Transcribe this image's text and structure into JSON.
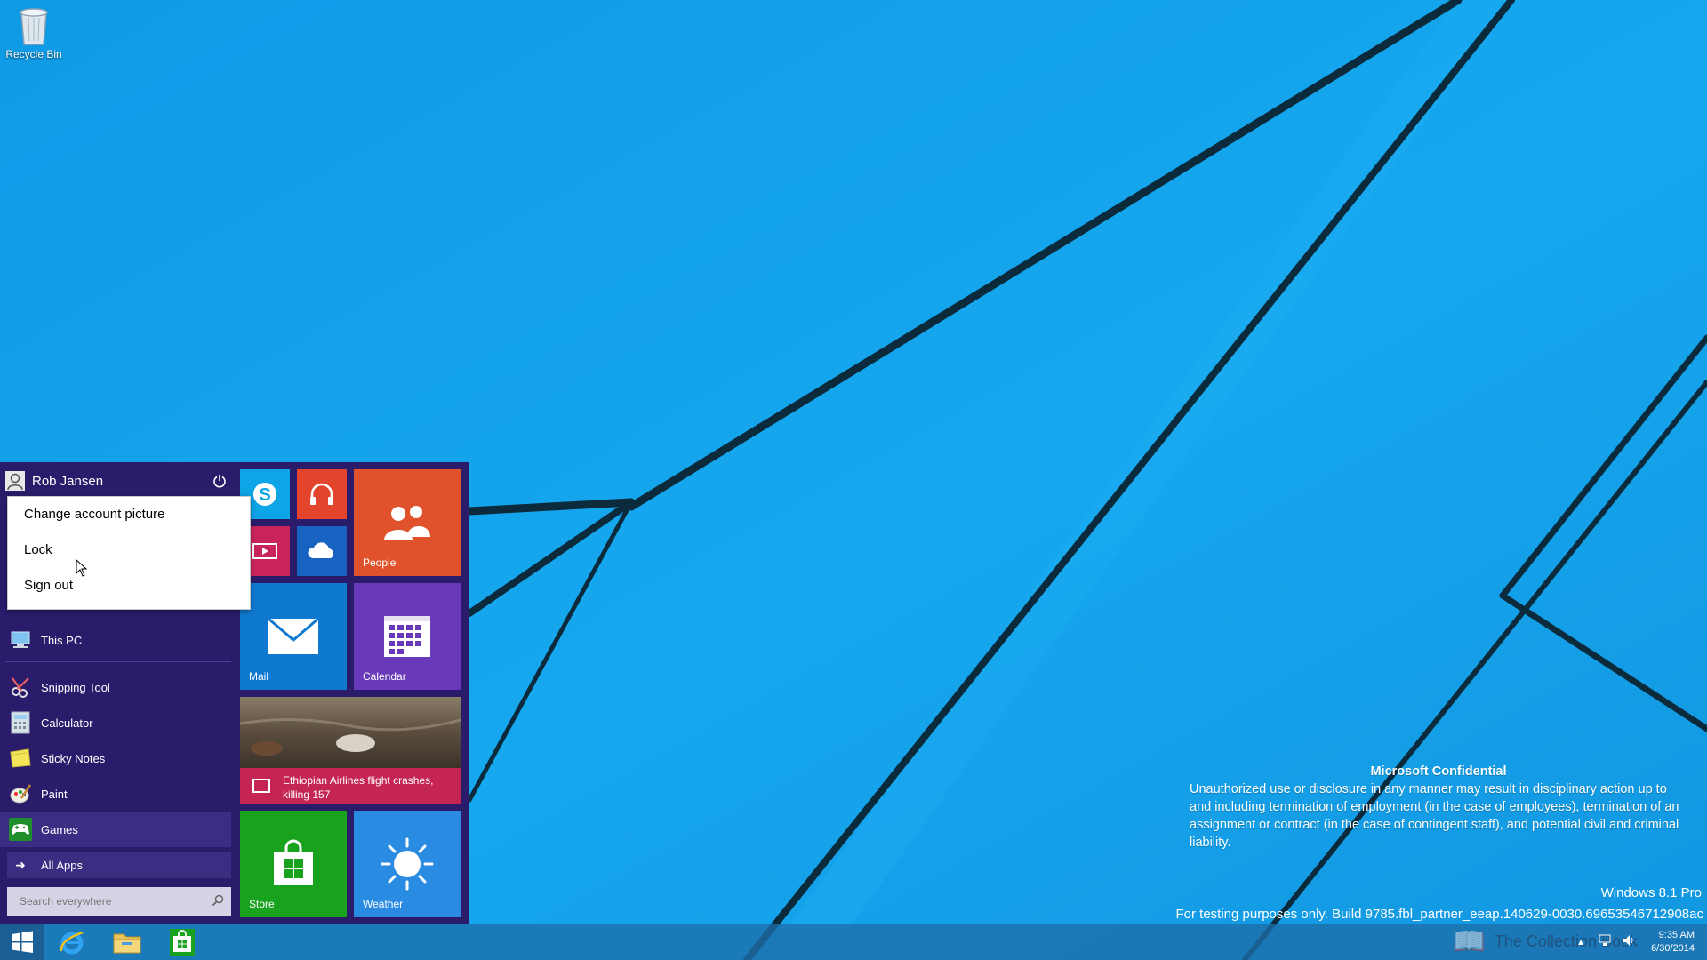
{
  "desktop": {
    "recycle_bin_label": "Recycle Bin"
  },
  "start_menu": {
    "user_name": "Rob Jansen",
    "account_menu": {
      "items": [
        "Change account picture",
        "Lock",
        "Sign out"
      ]
    },
    "apps": [
      {
        "label": "This PC",
        "icon": "computer-icon"
      },
      {
        "label": "Snipping Tool",
        "icon": "scissors-icon"
      },
      {
        "label": "Calculator",
        "icon": "calculator-icon"
      },
      {
        "label": "Sticky Notes",
        "icon": "sticky-note-icon"
      },
      {
        "label": "Paint",
        "icon": "palette-icon"
      },
      {
        "label": "Games",
        "icon": "gamepad-icon"
      }
    ],
    "all_apps_label": "All Apps",
    "search_placeholder": "Search everywhere",
    "tiles": {
      "people": "People",
      "mail": "Mail",
      "calendar": "Calendar",
      "news_headline": "Ethiopian Airlines flight crashes, killing 157",
      "store": "Store",
      "weather": "Weather"
    },
    "colors": {
      "background": "#2a1c6b",
      "skype": "#0ea5e6",
      "music": "#e2452c",
      "people": "#e0522c",
      "video": "#c9245a",
      "onedrive": "#1663c2",
      "mail": "#0f79cf",
      "calendar": "#6839b8",
      "news": "#c42552",
      "store": "#18a21e",
      "weather": "#2a8be3"
    }
  },
  "watermark": {
    "title": "Microsoft Confidential",
    "body": "Unauthorized use or disclosure in any manner may result in disciplinary action up to and including termination of employment (in the case of employees), termination of an assignment or contract (in the case of contingent staff), and potential civil and criminal liability.",
    "edition": "Windows 8.1 Pro",
    "build": "For testing purposes only. Build 9785.fbl_partner_eeap.140629-0030.69653546712908ac"
  },
  "taskbar": {
    "pinned": [
      "internet-explorer-icon",
      "file-explorer-icon",
      "store-icon"
    ],
    "time": "9:35 AM",
    "date": "6/30/2014",
    "overlay_text": "The Collection Book"
  }
}
